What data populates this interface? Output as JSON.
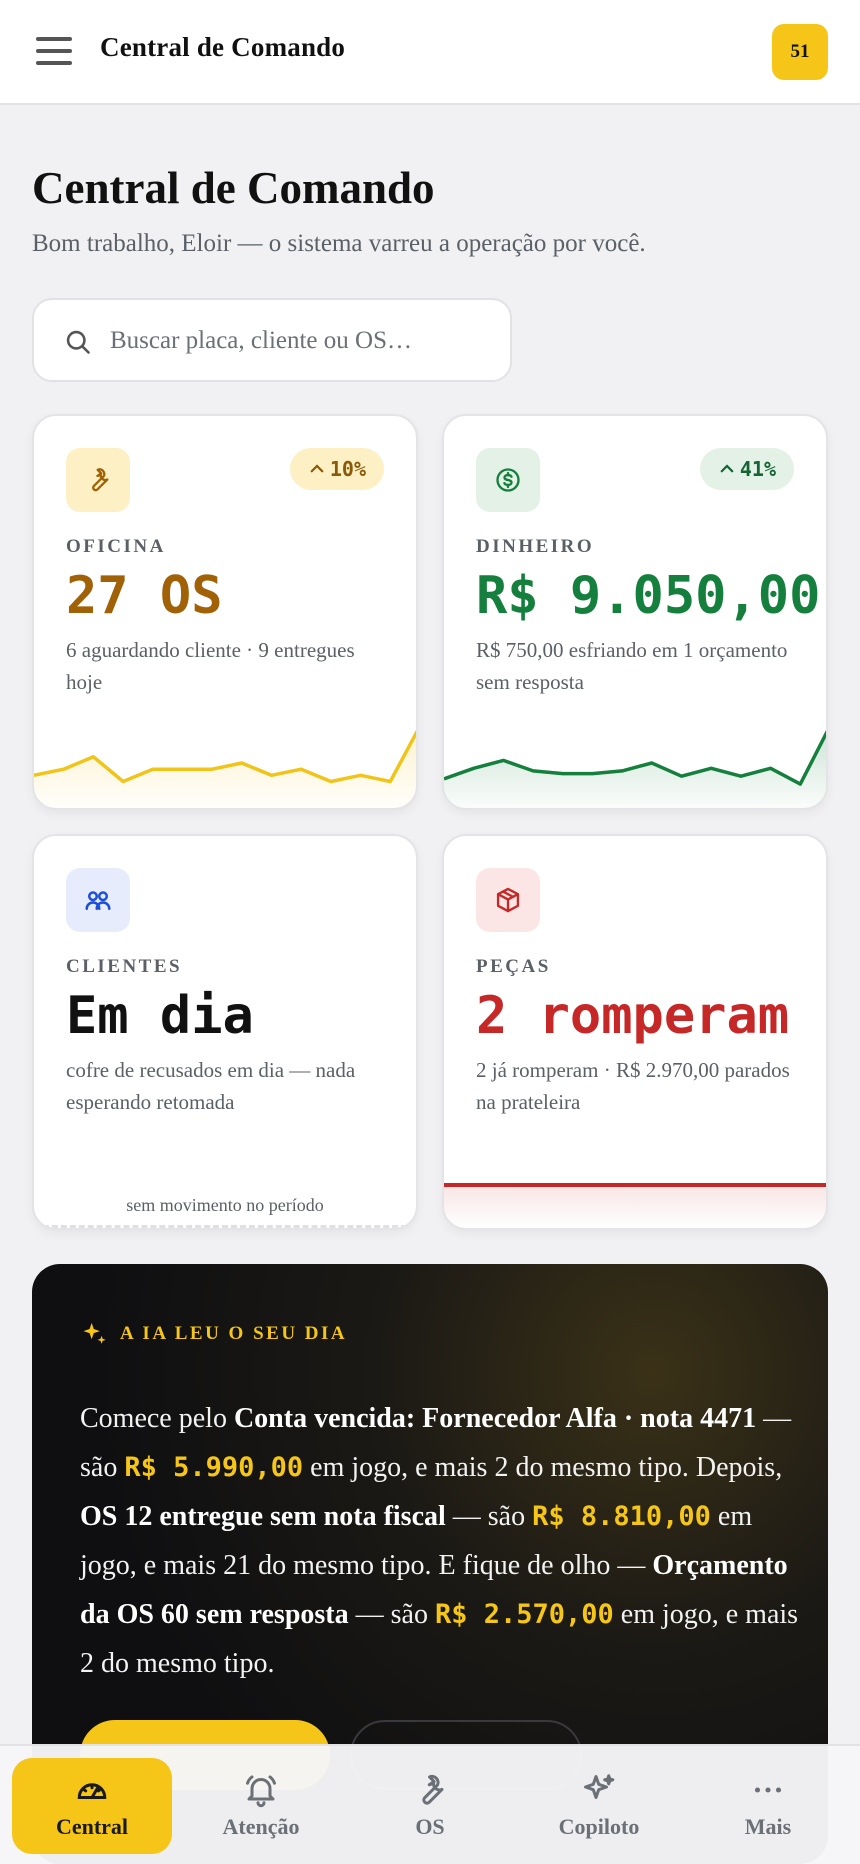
{
  "topbar": {
    "title": "Central de Comando",
    "notification_count": "51"
  },
  "header": {
    "title": "Central de Comando",
    "subtitle": "Bom trabalho, Eloir — o sistema varreu a operação por você."
  },
  "search": {
    "placeholder": "Buscar placa, cliente ou OS…",
    "value": ""
  },
  "cards": {
    "oficina": {
      "icon": "wrench-icon",
      "trend": "10%",
      "label": "OFICINA",
      "value": "27 OS",
      "description": "6 aguardando cliente · 9 entregues hoje",
      "color": "#a16207",
      "sparkline": [
        4,
        5,
        7,
        3,
        5,
        5,
        5,
        6,
        4,
        5,
        3,
        4,
        3,
        12
      ]
    },
    "dinheiro": {
      "icon": "dollar-icon",
      "trend": "41%",
      "label": "DINHEIRO",
      "value": "R$ 9.050,00",
      "description": "R$ 750,00 esfriando em 1 orçamento sem resposta",
      "color": "#15803d",
      "sparkline": [
        4,
        6,
        7.5,
        5.5,
        5,
        5,
        5.5,
        7,
        4.5,
        6,
        4.5,
        6,
        3,
        14
      ]
    },
    "clientes": {
      "icon": "users-icon",
      "label": "CLIENTES",
      "value": "Em dia",
      "description": "cofre de recusados em dia — nada esperando retomada",
      "footer": "sem movimento no período",
      "color": "#111111"
    },
    "pecas": {
      "icon": "package-icon",
      "label": "PEÇAS",
      "value": "2 romperam",
      "description": "2 já romperam · R$ 2.970,00 parados na prateleira",
      "color": "#c62828"
    }
  },
  "ai": {
    "heading": "A IA LEU O SEU DIA",
    "t1": "Comece pelo ",
    "b1": "Conta vencida: Fornecedor Alfa · nota 4471",
    "t2": " — são ",
    "a1": "R$ 5.990,00",
    "t3": " em jogo, e mais 2 do mesmo tipo. Depois, ",
    "b2": "OS 12 entregue sem nota fiscal",
    "t4": " — são ",
    "a2": "R$ 8.810,00",
    "t5": " em jogo, e mais 21 do mesmo tipo. E fique de olho — ",
    "b3": "Orçamento da OS 60 sem resposta",
    "t6": " — são ",
    "a3": "R$ 2.570,00",
    "t7": " em jogo, e mais 2 do mesmo tipo."
  },
  "nav": {
    "items": [
      {
        "label": "Central",
        "icon": "gauge-icon"
      },
      {
        "label": "Atenção",
        "icon": "bell-icon"
      },
      {
        "label": "OS",
        "icon": "wrench-icon"
      },
      {
        "label": "Copiloto",
        "icon": "sparkles-icon"
      },
      {
        "label": "Mais",
        "icon": "more-icon"
      }
    ]
  },
  "colors": {
    "accent": "#f5c518",
    "background": "#f1f1f3"
  }
}
